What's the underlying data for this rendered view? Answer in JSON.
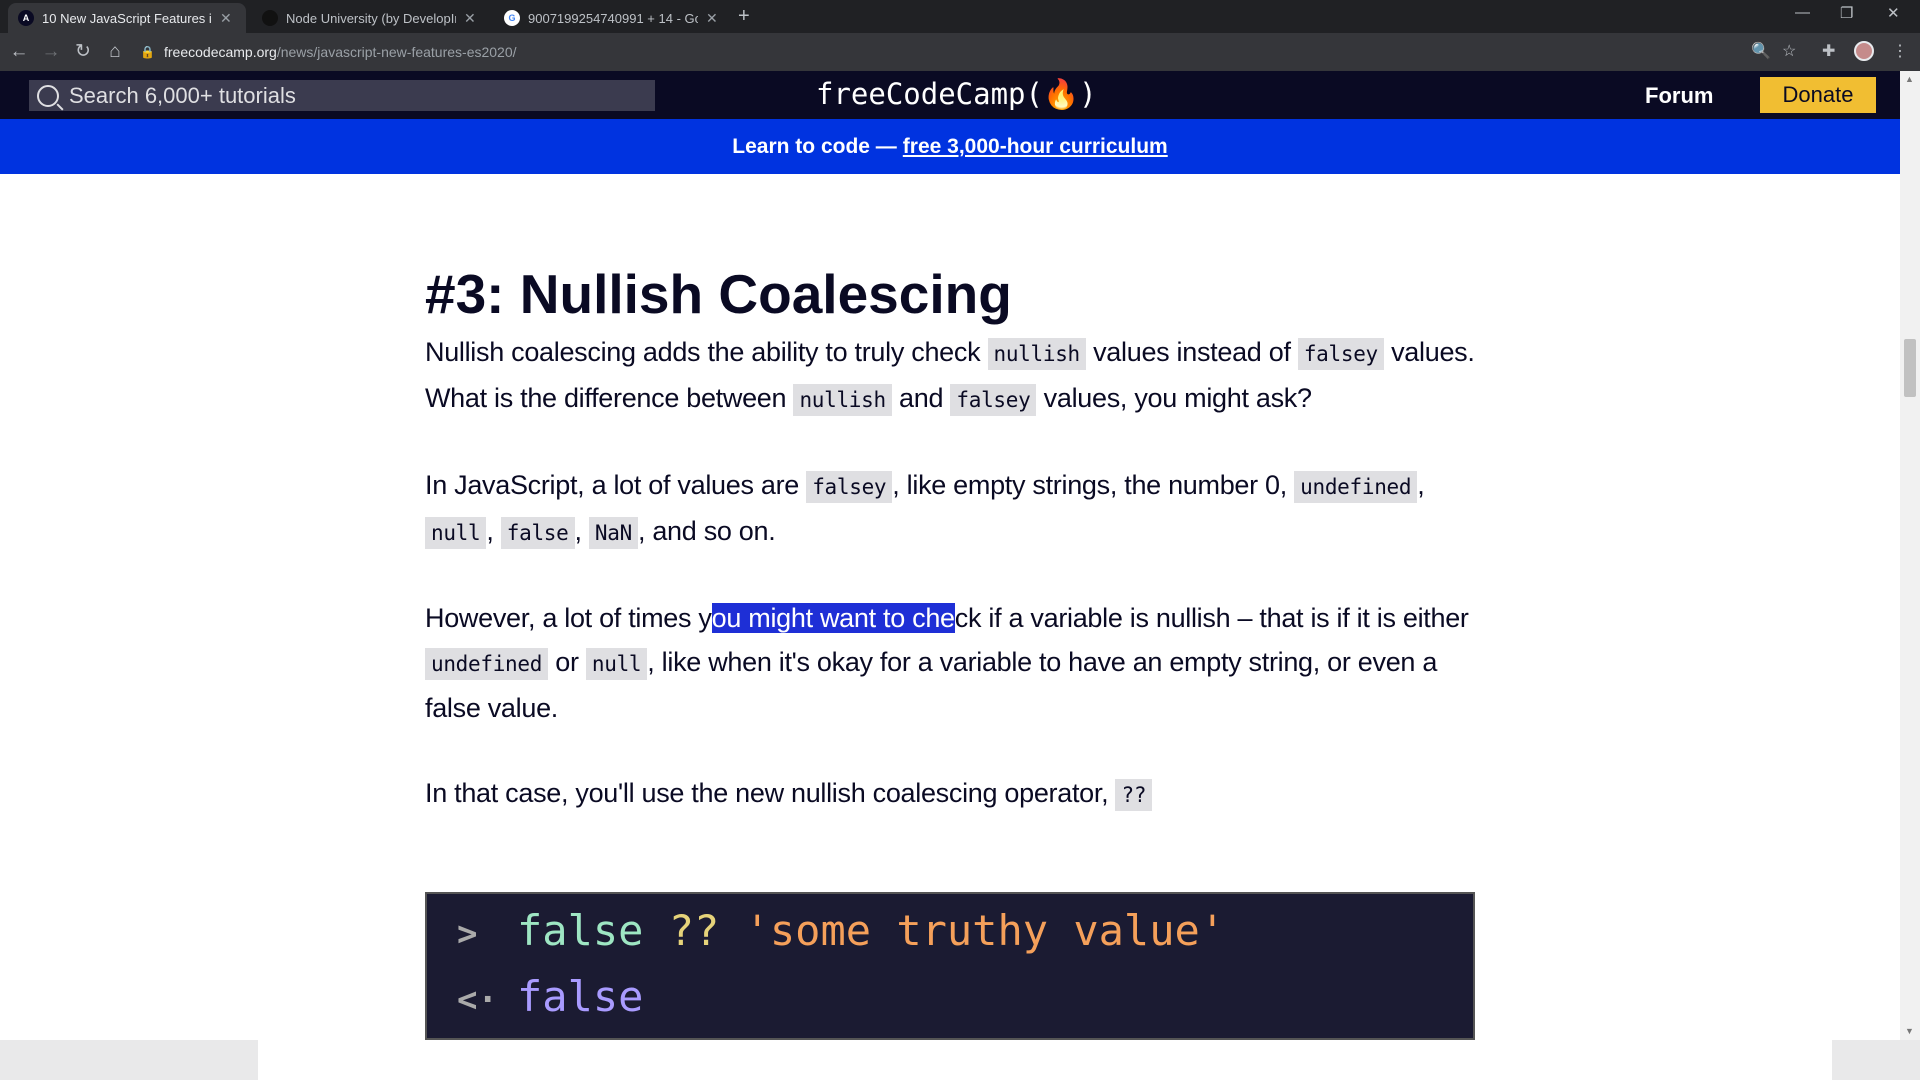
{
  "browser": {
    "tabs": [
      {
        "title": "10 New JavaScript Features in ES",
        "favicon": "A",
        "active": true
      },
      {
        "title": "Node University (by DevelopInte",
        "favicon": "",
        "active": false
      },
      {
        "title": "9007199254740991 + 14 - Goog",
        "favicon": "G",
        "active": false
      }
    ],
    "new_tab": "+",
    "url_host": "freecodecamp.org",
    "url_path": "/news/javascript-new-features-es2020/"
  },
  "site": {
    "search_placeholder": "Search 6,000+ tutorials",
    "logo": "freeCodeCamp(🔥)",
    "forum": "Forum",
    "donate": "Donate",
    "banner_text": "Learn to code —",
    "banner_link": "free 3,000-hour curriculum"
  },
  "article": {
    "heading": "#3: Nullish Coalescing",
    "p1": {
      "t1": "Nullish coalescing adds the ability to truly check ",
      "c1": "nullish",
      "t2": " values instead of ",
      "c2": "falsey",
      "t3": " values. What is the difference between ",
      "c3": "nullish",
      "t4": " and ",
      "c4": "falsey",
      "t5": " values, you might ask?"
    },
    "p2": {
      "t1": "In JavaScript, a lot of values are ",
      "c1": "falsey",
      "t2": ", like empty strings, the number 0, ",
      "c2": "undefined",
      "t3": ", ",
      "c3": "null",
      "t4": ", ",
      "c4": "false",
      "t5": ", ",
      "c5": "NaN",
      "t6": ", and so on."
    },
    "p3": {
      "t1": "However, a lot of times y",
      "sel": "ou might want to che",
      "t2": "ck if a variable is nullish – that is if it is either ",
      "c1": "undefined",
      "t3": " or ",
      "c2": "null",
      "t4": ", like when it's okay for a variable to have an empty string, or even a false value."
    },
    "p4": {
      "t1": "In that case, you'll use the new nullish coalescing operator, ",
      "c1": "??"
    },
    "code": {
      "in_kw": "false",
      "in_op": "??",
      "in_str": "'some truthy value'",
      "out": "false"
    }
  },
  "colors": {
    "nav_bg": "#0a0a23",
    "banner_bg": "#0033e0",
    "donate_bg": "#f1be32",
    "selection": "#1e2fd6",
    "code_bg": "#1b1b32"
  }
}
